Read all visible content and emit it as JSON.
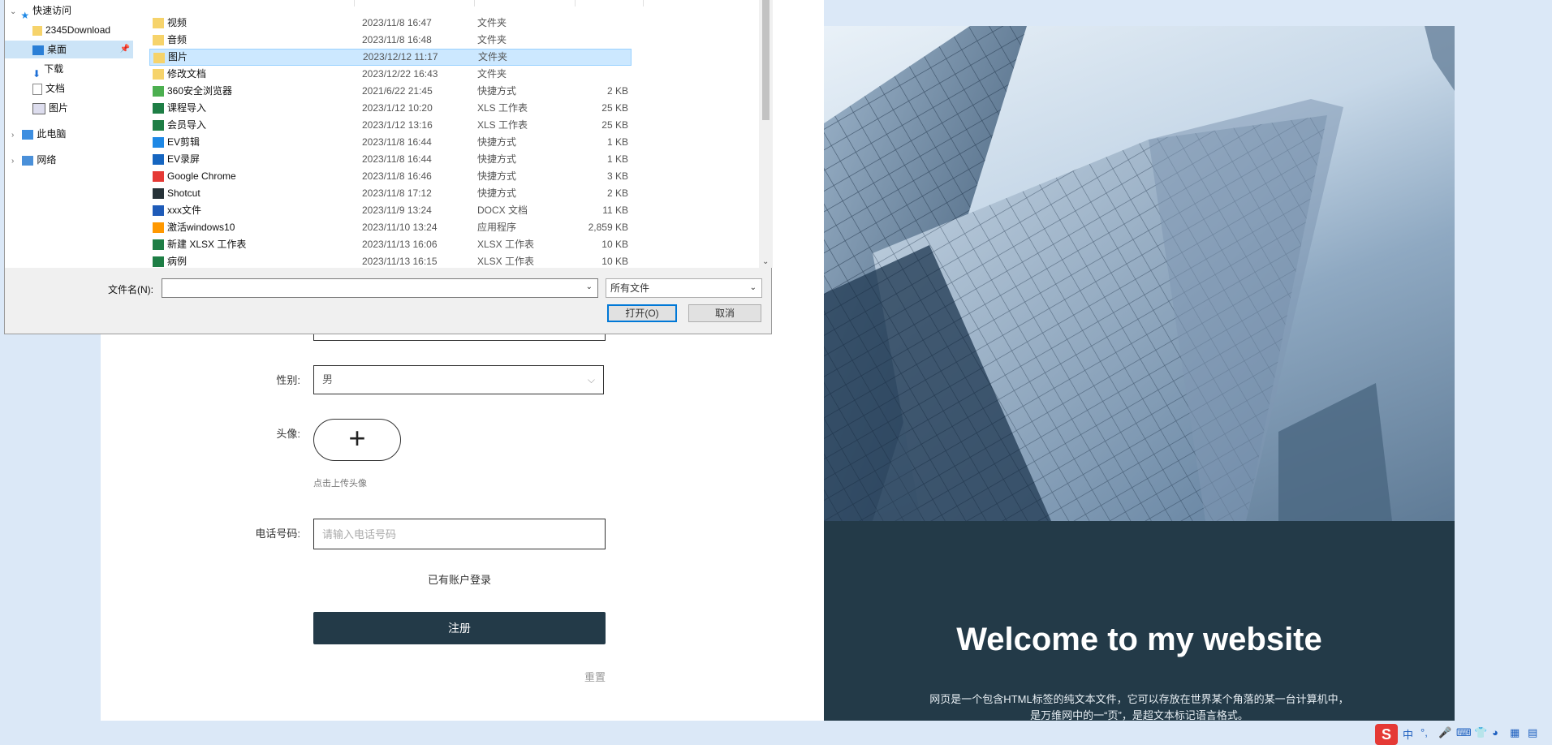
{
  "dialog": {
    "nav": [
      {
        "label": "快速访问",
        "icon": "star-icon",
        "expanded": true
      },
      {
        "label": "2345Download",
        "icon": "folder-icon",
        "pinned": true
      },
      {
        "label": "桌面",
        "icon": "desktop-icon",
        "pinned": true,
        "selected": true
      },
      {
        "label": "下载",
        "icon": "download-icon",
        "pinned": true
      },
      {
        "label": "文档",
        "icon": "document-icon",
        "pinned": true
      },
      {
        "label": "图片",
        "icon": "picture-icon",
        "pinned": true
      },
      {
        "label": "此电脑",
        "icon": "computer-icon"
      },
      {
        "label": "网络",
        "icon": "network-icon"
      }
    ],
    "files": [
      {
        "name": "视频",
        "date": "2023/11/8 16:47",
        "type": "文件夹",
        "size": "",
        "icon": "folder-icon"
      },
      {
        "name": "音频",
        "date": "2023/11/8 16:48",
        "type": "文件夹",
        "size": "",
        "icon": "folder-icon"
      },
      {
        "name": "图片",
        "date": "2023/12/12 11:17",
        "type": "文件夹",
        "size": "",
        "icon": "folder-icon",
        "selected": true
      },
      {
        "name": "修改文档",
        "date": "2023/12/22 16:43",
        "type": "文件夹",
        "size": "",
        "icon": "folder-icon"
      },
      {
        "name": "360安全浏览器",
        "date": "2021/6/22 21:45",
        "type": "快捷方式",
        "size": "2 KB",
        "icon": "browser-360-icon"
      },
      {
        "name": "课程导入",
        "date": "2023/1/12 10:20",
        "type": "XLS 工作表",
        "size": "25 KB",
        "icon": "excel-icon"
      },
      {
        "name": "会员导入",
        "date": "2023/1/12 13:16",
        "type": "XLS 工作表",
        "size": "25 KB",
        "icon": "excel-icon"
      },
      {
        "name": "EV剪辑",
        "date": "2023/11/8 16:44",
        "type": "快捷方式",
        "size": "1 KB",
        "icon": "ev-edit-icon"
      },
      {
        "name": "EV录屏",
        "date": "2023/11/8 16:44",
        "type": "快捷方式",
        "size": "1 KB",
        "icon": "ev-record-icon"
      },
      {
        "name": "Google Chrome",
        "date": "2023/11/8 16:46",
        "type": "快捷方式",
        "size": "3 KB",
        "icon": "chrome-icon"
      },
      {
        "name": "Shotcut",
        "date": "2023/11/8 17:12",
        "type": "快捷方式",
        "size": "2 KB",
        "icon": "shotcut-icon"
      },
      {
        "name": "xxx文件",
        "date": "2023/11/9 13:24",
        "type": "DOCX 文档",
        "size": "11 KB",
        "icon": "word-icon"
      },
      {
        "name": "激活windows10",
        "date": "2023/11/10 13:24",
        "type": "应用程序",
        "size": "2,859 KB",
        "icon": "windows-icon"
      },
      {
        "name": "新建 XLSX 工作表",
        "date": "2023/11/13 16:06",
        "type": "XLSX 工作表",
        "size": "10 KB",
        "icon": "excel-icon"
      },
      {
        "name": "病例",
        "date": "2023/11/13 16:15",
        "type": "XLSX 工作表",
        "size": "10 KB",
        "icon": "excel-icon"
      }
    ],
    "filename_label": "文件名(N):",
    "filename_value": "",
    "file_type": "所有文件",
    "open_label": "打开(O)",
    "cancel_label": "取消"
  },
  "form": {
    "gender_label": "性别:",
    "gender_value": "男",
    "avatar_label": "头像:",
    "avatar_plus": "+",
    "avatar_hint": "点击上传头像",
    "phone_label": "电话号码:",
    "phone_placeholder": "请输入电话号码",
    "login_link": "已有账户登录",
    "register_label": "注册",
    "reset_label": "重置"
  },
  "hero": {
    "title": "Welcome to my website",
    "desc_line1": "网页是一个包含HTML标签的纯文本文件，它可以存放在世界某个角落的某一台计算机中，",
    "desc_line2": "是万维网中的一“页”，是超文本标记语言格式。"
  },
  "tray": {
    "ime_logo": "S",
    "ime_mode": "中"
  }
}
